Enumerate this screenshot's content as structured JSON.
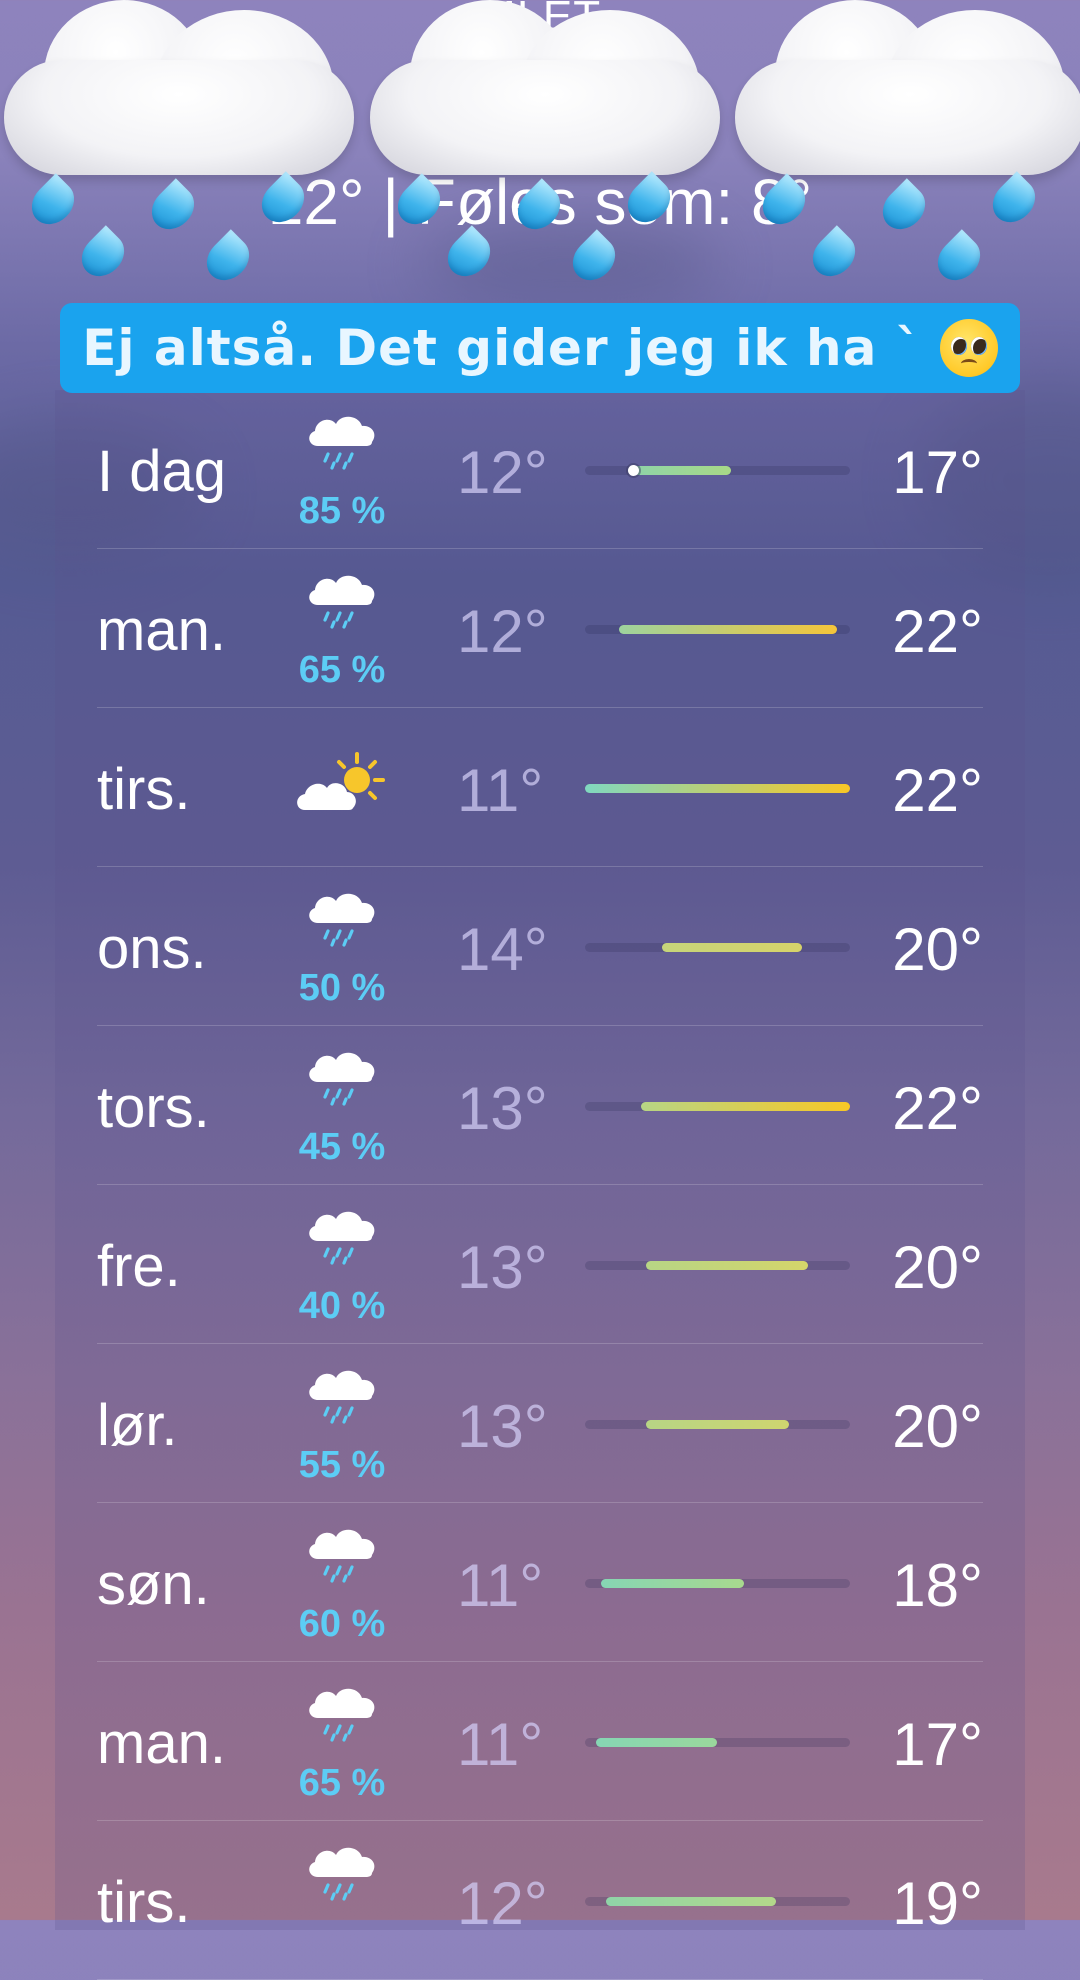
{
  "header": {
    "location": "MI                    ET",
    "temp_feels": "12° | Føles som: 8°"
  },
  "banner": {
    "text": "Ej altså. Det gider jeg ik ha `",
    "emoji": "pleading-face-emoji"
  },
  "stickers": {
    "icon": "cloud-with-rain-emoji",
    "count": 3
  },
  "forecast": [
    {
      "day": "I dag",
      "icon": "rain-cloud-icon",
      "precip": "85 %",
      "low": "12°",
      "high": "17°",
      "bar_start": 0.18,
      "bar_end": 0.55,
      "bar_from": "#8fd4a8",
      "bar_to": "#a8d987",
      "current": 0.18
    },
    {
      "day": "man.",
      "icon": "rain-cloud-icon",
      "precip": "65 %",
      "low": "12°",
      "high": "22°",
      "bar_start": 0.13,
      "bar_end": 0.95,
      "bar_from": "#9dd39e",
      "bar_to": "#f5c53a"
    },
    {
      "day": "tirs.",
      "icon": "partly-sunny-icon",
      "precip": "",
      "low": "11°",
      "high": "22°",
      "bar_start": 0.0,
      "bar_end": 1.0,
      "bar_from": "#80d8c0",
      "bar_to": "#f8c726"
    },
    {
      "day": "ons.",
      "icon": "rain-cloud-icon",
      "precip": "50 %",
      "low": "14°",
      "high": "20°",
      "bar_start": 0.29,
      "bar_end": 0.82,
      "bar_from": "#c6d57a",
      "bar_to": "#d7d36a"
    },
    {
      "day": "tors.",
      "icon": "rain-cloud-icon",
      "precip": "45 %",
      "low": "13°",
      "high": "22°",
      "bar_start": 0.21,
      "bar_end": 1.0,
      "bar_from": "#b7d585",
      "bar_to": "#f8c726"
    },
    {
      "day": "fre.",
      "icon": "rain-cloud-icon",
      "precip": "40 %",
      "low": "13°",
      "high": "20°",
      "bar_start": 0.23,
      "bar_end": 0.84,
      "bar_from": "#b7d585",
      "bar_to": "#d5d56a"
    },
    {
      "day": "lør.",
      "icon": "rain-cloud-icon",
      "precip": "55 %",
      "low": "13°",
      "high": "20°",
      "bar_start": 0.23,
      "bar_end": 0.77,
      "bar_from": "#b7d585",
      "bar_to": "#cfd56f"
    },
    {
      "day": "søn.",
      "icon": "rain-cloud-icon",
      "precip": "60 %",
      "low": "11°",
      "high": "18°",
      "bar_start": 0.06,
      "bar_end": 0.6,
      "bar_from": "#86d6b4",
      "bar_to": "#a8d98e"
    },
    {
      "day": "man.",
      "icon": "rain-cloud-icon",
      "precip": "65 %",
      "low": "11°",
      "high": "17°",
      "bar_start": 0.04,
      "bar_end": 0.5,
      "bar_from": "#86d6b4",
      "bar_to": "#9ad89c"
    },
    {
      "day": "tirs.",
      "icon": "rain-cloud-icon",
      "precip": "",
      "low": "12°",
      "high": "19°",
      "bar_start": 0.08,
      "bar_end": 0.72,
      "bar_from": "#8fd4a8",
      "bar_to": "#b3d88a"
    }
  ]
}
